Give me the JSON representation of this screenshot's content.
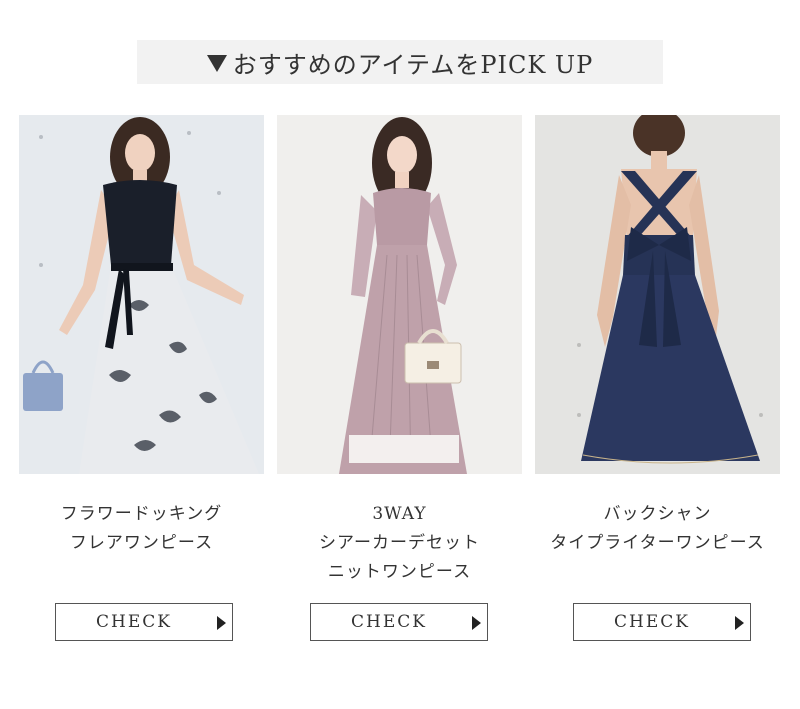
{
  "section": {
    "title": "おすすめのアイテムをPICK UP"
  },
  "products": [
    {
      "name_lines": [
        "フラワードッキング",
        "フレアワンピース"
      ],
      "cta": "CHECK",
      "photo_icon": "model-photo"
    },
    {
      "name_lines": [
        "3WAY",
        "シアーカーデセット",
        "ニットワンピース"
      ],
      "cta": "CHECK",
      "photo_icon": "model-photo"
    },
    {
      "name_lines": [
        "バックシャン",
        "タイプライターワンピース"
      ],
      "cta": "CHECK",
      "photo_icon": "model-photo"
    }
  ],
  "colors": {
    "banner_bg": "#f2f2f2",
    "text": "#333333",
    "border": "#555555"
  }
}
